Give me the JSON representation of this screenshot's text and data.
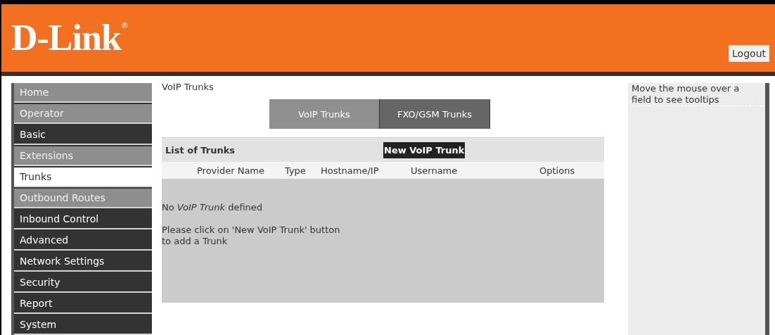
{
  "header": {
    "logo": "D-Link",
    "logo_mark": "®",
    "logout": "Logout"
  },
  "sidebar": {
    "items": [
      {
        "label": "Home",
        "kind": "light",
        "selected": false
      },
      {
        "label": "Operator",
        "kind": "light",
        "selected": false
      },
      {
        "label": "Basic",
        "kind": "dark",
        "selected": false
      },
      {
        "label": "Extensions",
        "kind": "light",
        "selected": false
      },
      {
        "label": "Trunks",
        "kind": "light",
        "selected": true
      },
      {
        "label": "Outbound Routes",
        "kind": "light",
        "selected": false
      },
      {
        "label": "Inbound Control",
        "kind": "dark",
        "selected": false
      },
      {
        "label": "Advanced",
        "kind": "dark",
        "selected": false
      },
      {
        "label": "Network Settings",
        "kind": "dark",
        "selected": false
      },
      {
        "label": "Security",
        "kind": "dark",
        "selected": false
      },
      {
        "label": "Report",
        "kind": "dark",
        "selected": false
      },
      {
        "label": "System",
        "kind": "dark",
        "selected": false
      }
    ]
  },
  "page_title": "VoIP Trunks",
  "tabs": [
    {
      "label": "VoIP Trunks",
      "selected": true
    },
    {
      "label": "FXO/GSM Trunks",
      "selected": false
    }
  ],
  "trunks": {
    "title": "List of Trunks",
    "new_button": "New VoIP Trunk",
    "columns": [
      "Provider Name",
      "Type",
      "Hostname/IP",
      "Username",
      "Options"
    ],
    "empty_message": "No *VoIP Trunk* defined",
    "hint": "Please click on 'New VoIP Trunk' button\nto add a Trunk"
  },
  "help": {
    "text": "Move the mouse over a\nfield to see tooltips"
  }
}
